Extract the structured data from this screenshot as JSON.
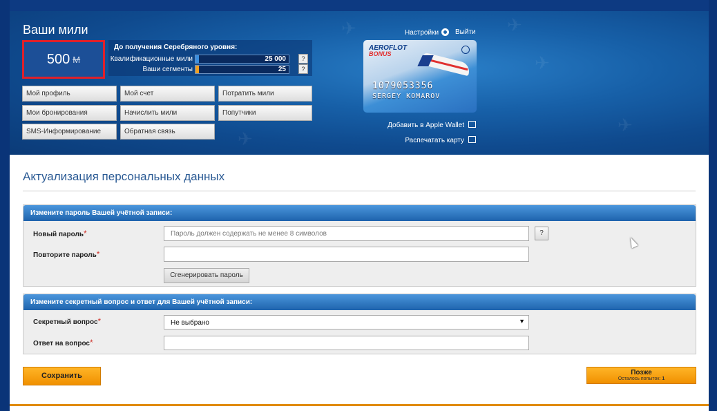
{
  "header": {
    "title": "Ваши мили",
    "miles_value": "500",
    "miles_unit": "M",
    "settings_label": "Настройки",
    "logout_label": "Выйти",
    "silver": {
      "title": "До получения Серебряного уровня:",
      "rows": [
        {
          "label": "Квалификационные мили",
          "value": "25 000",
          "progress": 0.0,
          "color": "#3a8fe0",
          "help": "?"
        },
        {
          "label": "Ваши сегменты",
          "value": "25",
          "progress": 0.0,
          "color": "#f0a020",
          "help": "?"
        }
      ]
    },
    "menu": [
      [
        "Мой профиль",
        "Мой счет",
        "Потратить мили"
      ],
      [
        "Мои бронирования",
        "Начислить мили",
        "Попутчики"
      ],
      [
        "SMS-Информирование",
        "Обратная связь"
      ]
    ],
    "card": {
      "brand_line1": "AEROFLOT",
      "brand_line2": "BONUS",
      "number": "1079053356",
      "holder": "SERGEY KOMAROV"
    },
    "apple_wallet_label": "Добавить в Apple Wallet",
    "print_card_label": "Распечатать карту"
  },
  "main": {
    "page_title": "Актуализация персональных данных",
    "password_section": {
      "title": "Измените пароль Вашей учётной записи:",
      "new_password_label": "Новый пароль",
      "new_password_placeholder": "Пароль должен содержать не менее 8 символов",
      "repeat_password_label": "Повторите пароль",
      "required_mark": "*",
      "help": "?",
      "generate_label": "Сгенерировать пароль"
    },
    "secret_section": {
      "title": "Измените секретный вопрос и ответ для Вашей учётной записи:",
      "question_label": "Секретный вопрос",
      "question_value": "Не выбрано",
      "answer_label": "Ответ на вопрос",
      "required_mark": "*"
    },
    "save_label": "Сохранить",
    "later_label": "Позже",
    "attempts_label": "Осталось попыток:",
    "attempts_value": "1"
  }
}
